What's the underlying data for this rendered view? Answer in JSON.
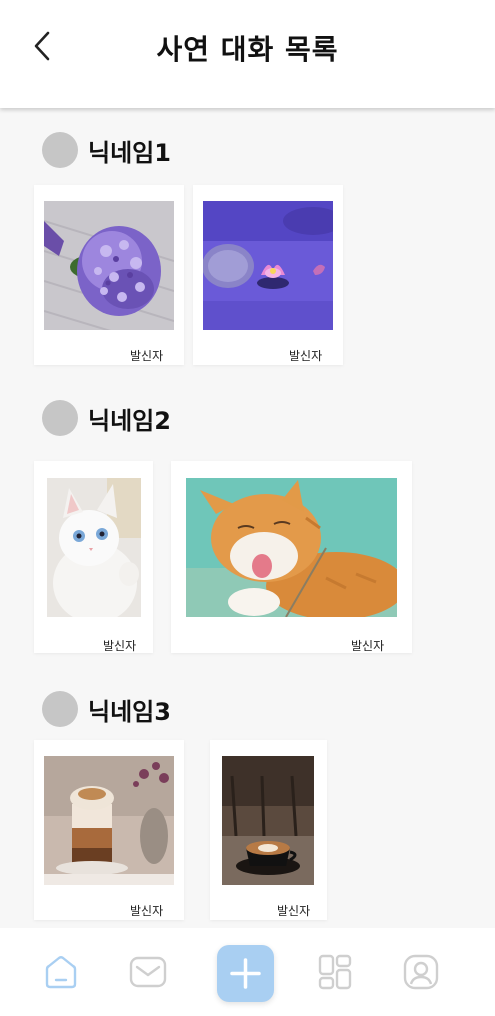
{
  "header": {
    "title": "사연 대화 목록",
    "back_icon": "chevron-left-icon"
  },
  "sections": [
    {
      "nickname": "닉네임1",
      "cards": [
        {
          "sender": "발신자",
          "photo": "purple-flower-bouquet"
        },
        {
          "sender": "발신자",
          "photo": "pink-water-lily"
        }
      ]
    },
    {
      "nickname": "닉네임2",
      "cards": [
        {
          "sender": "발신자",
          "photo": "white-kitten"
        },
        {
          "sender": "발신자",
          "photo": "orange-cat-licking"
        }
      ]
    },
    {
      "nickname": "닉네임3",
      "cards": [
        {
          "sender": "발신자",
          "photo": "iced-coffee-glass"
        },
        {
          "sender": "발신자",
          "photo": "latte-cup"
        }
      ]
    }
  ],
  "nav": {
    "items": [
      "home-icon",
      "mail-icon",
      "add-icon",
      "grid-icon",
      "profile-icon"
    ],
    "accent": "#a9cff2",
    "active_color": "#a9cff2",
    "inactive_color": "#cfcfcf"
  }
}
